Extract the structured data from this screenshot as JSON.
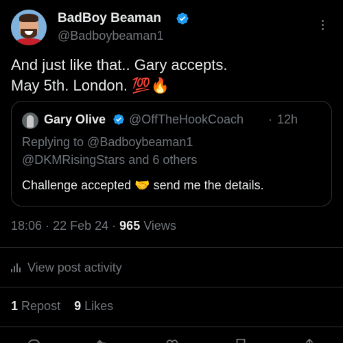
{
  "post": {
    "author": {
      "name": "BadBoy Beaman",
      "handle": "@Badboybeaman1",
      "verified": true
    },
    "text_line1": "And just like that.. Gary accepts.",
    "text_line2": "May 5th. London.",
    "text_emojis": "💯🔥",
    "time": "18:06",
    "sep1": "·",
    "date": "22 Feb 24",
    "sep2": "·",
    "views_count": "965",
    "views_label": "Views"
  },
  "quote": {
    "name": "Gary Olive",
    "handle": "@OffTheHookCoach",
    "sep": "·",
    "time": "12h",
    "reply_line1": "Replying to @Badboybeaman1",
    "reply_line2": "@DKMRisingStars and 6 others",
    "body_before": "Challenge accepted",
    "body_emoji": "🤝",
    "body_after": "send me the details."
  },
  "activity": {
    "label": "View post activity",
    "icon": "analytics-bars-icon"
  },
  "engagement": {
    "reposts_count": "1",
    "reposts_label": "Repost",
    "likes_count": "9",
    "likes_label": "Likes"
  },
  "colors": {
    "background": "#000000",
    "text": "#e7e9ea",
    "secondary": "#71767b",
    "verified": "#1d9bf0",
    "border": "#2f3336"
  }
}
